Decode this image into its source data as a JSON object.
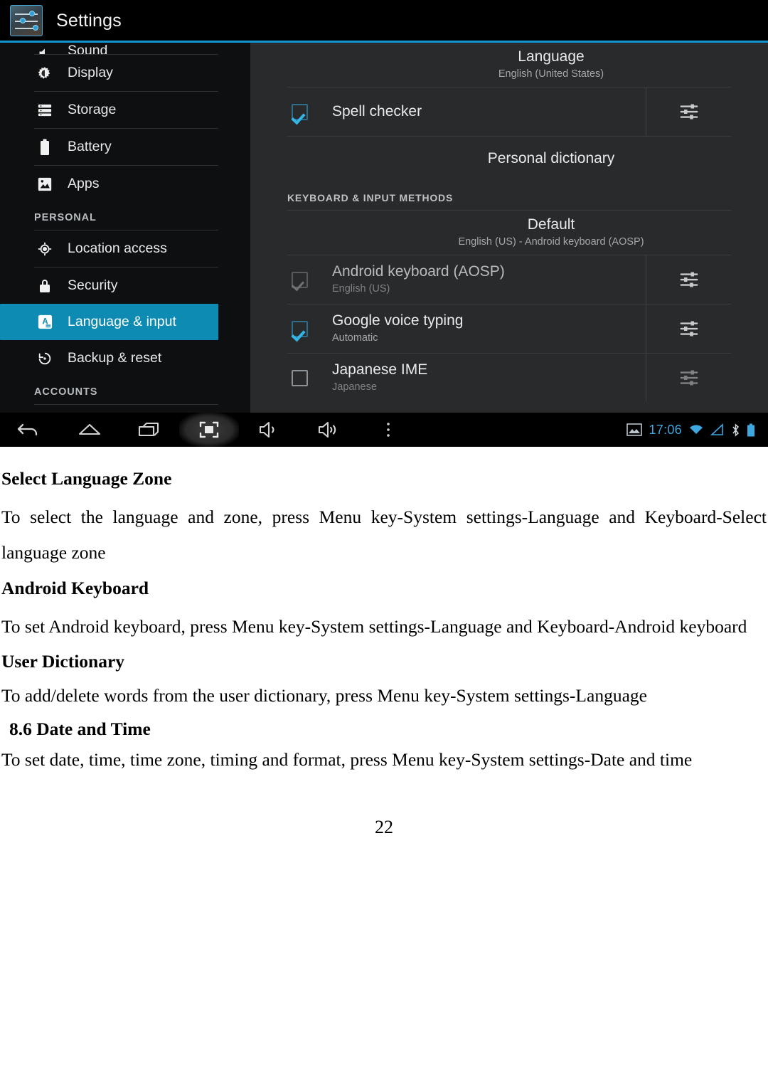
{
  "screenshot": {
    "app_title": "Settings",
    "app_icon": "settings-sliders-icon",
    "sidebar": {
      "cut_item": {
        "label": "Sound",
        "icon": "sound-icon"
      },
      "items": [
        {
          "label": "Display",
          "icon": "display-icon"
        },
        {
          "label": "Storage",
          "icon": "storage-icon"
        },
        {
          "label": "Battery",
          "icon": "battery-icon"
        },
        {
          "label": "Apps",
          "icon": "apps-icon"
        }
      ],
      "section_personal": "PERSONAL",
      "personal_items": [
        {
          "label": "Location access",
          "icon": "location-icon",
          "selected": false
        },
        {
          "label": "Security",
          "icon": "lock-icon",
          "selected": false
        },
        {
          "label": "Language & input",
          "icon": "language-icon",
          "selected": true
        },
        {
          "label": "Backup & reset",
          "icon": "backup-icon",
          "selected": false
        }
      ],
      "section_accounts": "ACCOUNTS"
    },
    "content": {
      "language": {
        "title": "Language",
        "subtitle": "English (United States)"
      },
      "spell_checker": {
        "title": "Spell checker",
        "checked": true,
        "has_settings": true
      },
      "personal_dictionary": {
        "title": "Personal dictionary"
      },
      "section_keyboard": "KEYBOARD & INPUT METHODS",
      "default": {
        "title": "Default",
        "subtitle": "English (US) - Android keyboard (AOSP)"
      },
      "methods": [
        {
          "title": "Android keyboard (AOSP)",
          "subtitle": "English (US)",
          "state": "dim-checked"
        },
        {
          "title": "Google voice typing",
          "subtitle": "Automatic",
          "state": "checked"
        },
        {
          "title": "Japanese IME",
          "subtitle": "Japanese",
          "state": "unchecked"
        }
      ]
    },
    "navbar": {
      "buttons": [
        {
          "name": "back-icon",
          "highlighted": false
        },
        {
          "name": "home-icon",
          "highlighted": false
        },
        {
          "name": "recents-icon",
          "highlighted": false
        },
        {
          "name": "screenshot-icon",
          "highlighted": true
        },
        {
          "name": "volume-down-icon",
          "highlighted": false
        },
        {
          "name": "volume-up-icon",
          "highlighted": false
        },
        {
          "name": "overflow-menu-icon",
          "highlighted": false
        }
      ],
      "status": {
        "screenshot_icon": "image-icon",
        "clock": "17:06",
        "wifi_icon": "wifi-icon",
        "signal_icon": "signal-icon",
        "bluetooth_icon": "bluetooth-icon",
        "battery_icon": "battery-icon"
      }
    },
    "accent_color": "#0e8bb3",
    "status_color": "#3ea7e0"
  },
  "document": {
    "sections": [
      {
        "heading": "Select Language Zone",
        "body": "To select the language and zone, press Menu key-System settings-Language and Keyboard-Select language zone"
      },
      {
        "heading": "Android Keyboard",
        "body": "To set Android keyboard, press Menu key-System settings-Language and Keyboard-Android keyboard"
      },
      {
        "heading": "User Dictionary",
        "body": "To add/delete words from the user dictionary, press Menu key-System settings-Language"
      }
    ],
    "numbered_heading": "8.6 Date and Time",
    "final_body": "To set date, time, time zone, timing and format, press Menu key-System settings-Date and time",
    "page_number": "22"
  }
}
